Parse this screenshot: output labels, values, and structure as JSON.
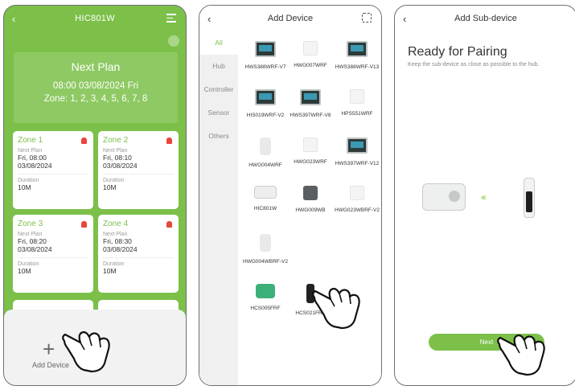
{
  "screen1": {
    "title": "HIC801W",
    "plan": {
      "heading": "Next Plan",
      "time": "08:00 03/08/2024 Fri",
      "zones": "Zone: 1, 2, 3, 4, 5, 6, 7, 8"
    },
    "zones": [
      {
        "name": "Zone 1",
        "next_label": "Next Plan",
        "next_day": "Fri, 08:00",
        "next_date": "03/08/2024",
        "duration_label": "Duration",
        "duration": "10M"
      },
      {
        "name": "Zone 2",
        "next_label": "Next Plan",
        "next_day": "Fri, 08:10",
        "next_date": "03/08/2024",
        "duration_label": "Duration",
        "duration": "10M"
      },
      {
        "name": "Zone 3",
        "next_label": "Next Plan",
        "next_day": "Fri, 08:20",
        "next_date": "03/08/2024",
        "duration_label": "Duration",
        "duration": "10M"
      },
      {
        "name": "Zone 4",
        "next_label": "Next Plan",
        "next_day": "Fri, 08:30",
        "next_date": "03/08/2024",
        "duration_label": "Duration",
        "duration": "10M"
      }
    ],
    "add_device": "Add Device"
  },
  "screen2": {
    "title": "Add Device",
    "categories": [
      "All",
      "Hub",
      "Controller",
      "Sensor",
      "Others"
    ],
    "devices": [
      {
        "name": "HWS388WRF-V7",
        "icon": "screen-device"
      },
      {
        "name": "HWG007WRF",
        "icon": "white-device"
      },
      {
        "name": "HWS388WRF-V13",
        "icon": "screen-device"
      },
      {
        "name": "HIS019WRF-V2",
        "icon": "screen-device"
      },
      {
        "name": "HWS397WRF-V8",
        "icon": "screen-device"
      },
      {
        "name": "HPS551WRF",
        "icon": "white-device"
      },
      {
        "name": "HWG004WRF",
        "icon": "plug-device"
      },
      {
        "name": "HWG023WRF",
        "icon": "white-device"
      },
      {
        "name": "HWS397WRF-V12",
        "icon": "screen-device"
      },
      {
        "name": "HIC801W",
        "icon": "hub-device"
      },
      {
        "name": "HWG009WB",
        "icon": "dark-device"
      },
      {
        "name": "HWG023WBRF-V2",
        "icon": "white-device"
      },
      {
        "name": "HWG004WBRF-V2",
        "icon": "plug-device"
      },
      {
        "name": "HCS005FRF",
        "icon": "valve-device"
      },
      {
        "name": "HCS021FRF",
        "icon": "tall-device"
      }
    ]
  },
  "screen3": {
    "title": "Add Sub-device",
    "heading": "Ready for Pairing",
    "subtitle": "Keep the sub-device as close as possible to the hub.",
    "next": "Next"
  },
  "colors": {
    "accent": "#7cc04a",
    "alarm": "#e8463d"
  }
}
